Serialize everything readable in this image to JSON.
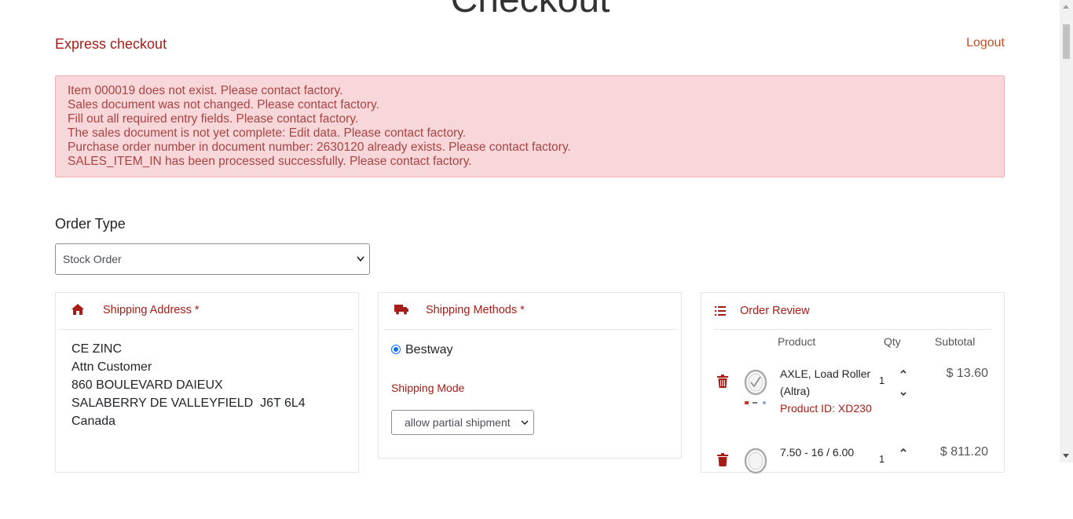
{
  "page_title": "Checkout",
  "header": {
    "express_checkout": "Express checkout",
    "logout": "Logout"
  },
  "alerts": [
    "Item 000019 does not exist. Please contact factory.",
    "Sales document was not changed. Please contact factory.",
    "Fill out all required entry fields. Please contact factory.",
    "The sales document is not yet complete: Edit data. Please contact factory.",
    "Purchase order number in document number: 2630120 already exists. Please contact factory.",
    "SALES_ITEM_IN has been processed successfully. Please contact factory."
  ],
  "order_type": {
    "label": "Order Type",
    "selected": "Stock Order"
  },
  "shipping_address": {
    "title": "Shipping Address *",
    "lines": [
      "CE ZINC",
      "Attn Customer",
      "860 BOULEVARD DAIEUX",
      "SALABERRY DE VALLEYFIELD  J6T 6L4",
      "Canada"
    ]
  },
  "shipping_methods": {
    "title": "Shipping Methods *",
    "option": "Bestway",
    "mode_label": "Shipping Mode",
    "mode_selected": "allow partial shipment"
  },
  "order_review": {
    "title": "Order Review",
    "columns": {
      "product": "Product",
      "qty": "Qty",
      "subtotal": "Subtotal"
    },
    "items": [
      {
        "name": "AXLE, Load Roller (Altra)",
        "product_id": "Product ID: XD230",
        "qty": "1",
        "subtotal": "$ 13.60"
      },
      {
        "name": "7.50 - 16 / 6.00",
        "product_id": "",
        "qty": "1",
        "subtotal": "$ 811.20"
      }
    ]
  },
  "colors": {
    "accent": "#a51d16",
    "alert_bg": "#f8d7da",
    "alert_text": "#a94442",
    "radio": "#0d6efd"
  },
  "icons": [
    "home-icon",
    "truck-icon",
    "list-icon",
    "trash-icon",
    "chevron-down-icon",
    "chevron-up-icon"
  ]
}
